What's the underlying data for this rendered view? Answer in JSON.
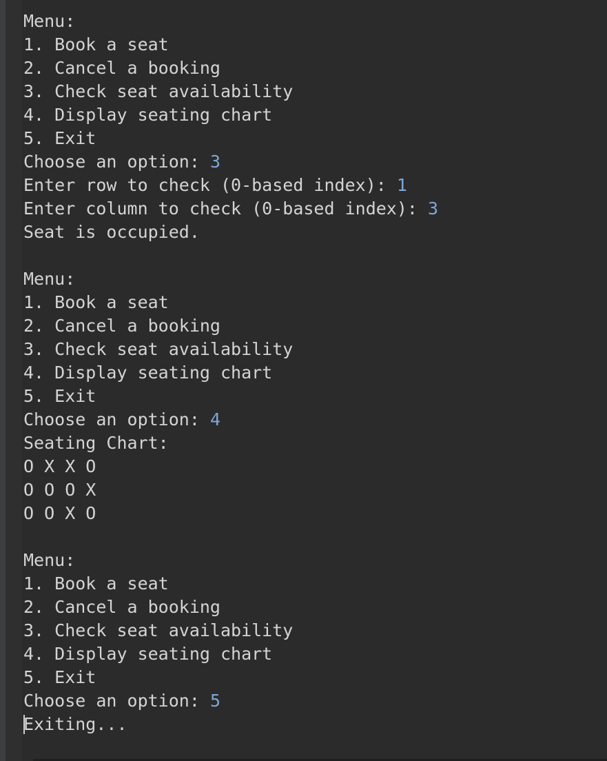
{
  "console": {
    "lines": [
      {
        "text": "Menu:"
      },
      {
        "text": "1. Book a seat"
      },
      {
        "text": "2. Cancel a booking"
      },
      {
        "text": "3. Check seat availability"
      },
      {
        "text": "4. Display seating chart"
      },
      {
        "text": "5. Exit"
      },
      {
        "text": "Choose an option: ",
        "input": "3"
      },
      {
        "text": "Enter row to check (0-based index): ",
        "input": "1"
      },
      {
        "text": "Enter column to check (0-based index): ",
        "input": "3"
      },
      {
        "text": "Seat is occupied."
      },
      {
        "text": ""
      },
      {
        "text": "Menu:"
      },
      {
        "text": "1. Book a seat"
      },
      {
        "text": "2. Cancel a booking"
      },
      {
        "text": "3. Check seat availability"
      },
      {
        "text": "4. Display seating chart"
      },
      {
        "text": "5. Exit"
      },
      {
        "text": "Choose an option: ",
        "input": "4"
      },
      {
        "text": "Seating Chart:"
      },
      {
        "text": "O X X O"
      },
      {
        "text": "O O O X"
      },
      {
        "text": "O O X O"
      },
      {
        "text": ""
      },
      {
        "text": "Menu:"
      },
      {
        "text": "1. Book a seat"
      },
      {
        "text": "2. Cancel a booking"
      },
      {
        "text": "3. Check seat availability"
      },
      {
        "text": "4. Display seating chart"
      },
      {
        "text": "5. Exit"
      },
      {
        "text": "Choose an option: ",
        "input": "5"
      },
      {
        "text": "Exiting...",
        "cursor": true
      }
    ]
  },
  "colors": {
    "background": "#2b2b2b",
    "output_text": "#d4d4d4",
    "user_input": "#7ea7d8"
  }
}
